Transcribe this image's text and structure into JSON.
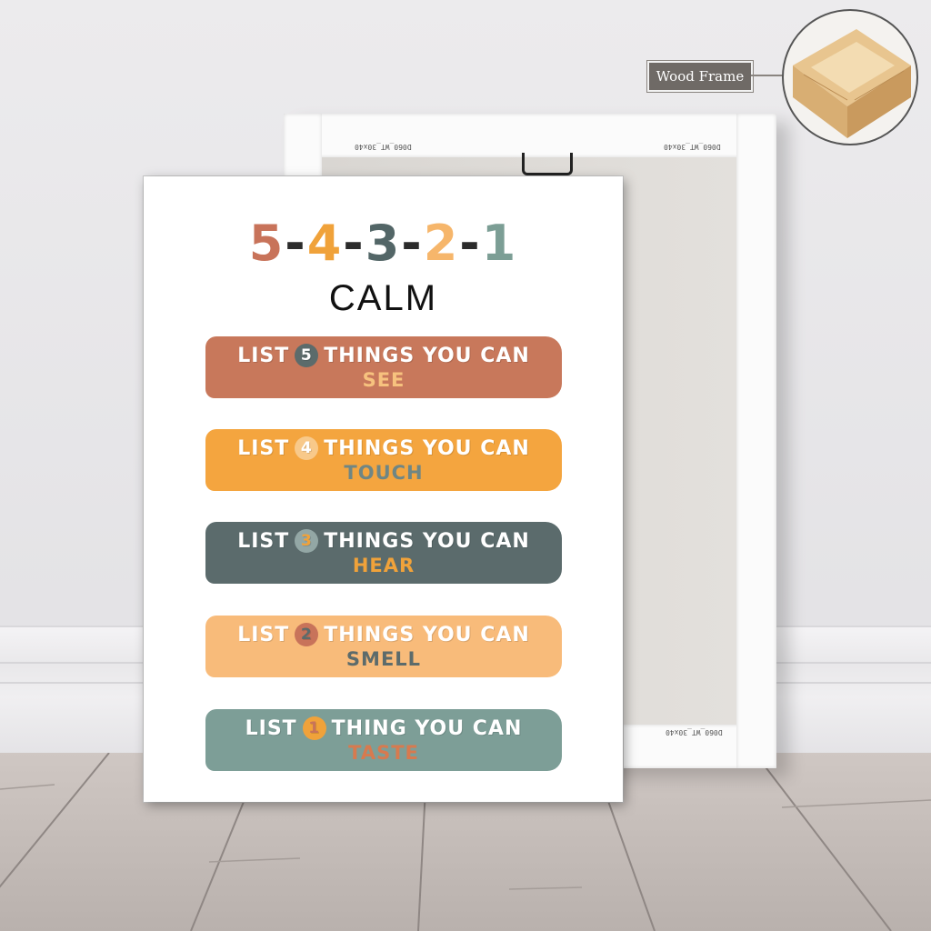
{
  "wood_callout": {
    "label": "Wood Frame"
  },
  "frame_back": {
    "stamp_top_left": "D060_WT_30x40",
    "stamp_top_right": "D060_WT_30x40",
    "stamp_bottom": "D060_WT_30x40"
  },
  "poster": {
    "title_digits": [
      {
        "text": "5",
        "color": "#c8735a"
      },
      {
        "text": "-",
        "color": "#2b2b2b"
      },
      {
        "text": "4",
        "color": "#f0a23a"
      },
      {
        "text": "-",
        "color": "#2b2b2b"
      },
      {
        "text": "3",
        "color": "#536667"
      },
      {
        "text": "-",
        "color": "#2b2b2b"
      },
      {
        "text": "2",
        "color": "#f6b66b"
      },
      {
        "text": "-",
        "color": "#2b2b2b"
      },
      {
        "text": "1",
        "color": "#7c9e95"
      }
    ],
    "subtitle": "CALM",
    "bands": [
      {
        "prefix": "LIST",
        "number": "5",
        "suffix": "THINGS YOU CAN",
        "sense": "SEE",
        "band_color": "#c8785b",
        "number_bg": "#5c6b6b",
        "number_color": "#ffffff",
        "sense_color": "#f7c27e"
      },
      {
        "prefix": "LIST",
        "number": "4",
        "suffix": "THINGS YOU CAN",
        "sense": "TOUCH",
        "band_color": "#f4a53f",
        "number_bg": "#f8c98a",
        "number_color": "#ffffff",
        "sense_color": "#6f8684"
      },
      {
        "prefix": "LIST",
        "number": "3",
        "suffix": "THINGS YOU CAN",
        "sense": "HEAR",
        "band_color": "#5b6b6c",
        "number_bg": "#93a7a5",
        "number_color": "#f0a23a",
        "sense_color": "#f0a23a"
      },
      {
        "prefix": "LIST",
        "number": "2",
        "suffix": "THINGS YOU CAN",
        "sense": "SMELL",
        "band_color": "#f8bb7a",
        "number_bg": "#c8735a",
        "number_color": "#5c6b6b",
        "sense_color": "#5c6b6b"
      },
      {
        "prefix": "LIST",
        "number": "1",
        "suffix": "THING YOU CAN",
        "sense": "TASTE",
        "band_color": "#7d9e97",
        "number_bg": "#f0a23a",
        "number_color": "#c8735a",
        "sense_color": "#d77a4f"
      }
    ]
  }
}
